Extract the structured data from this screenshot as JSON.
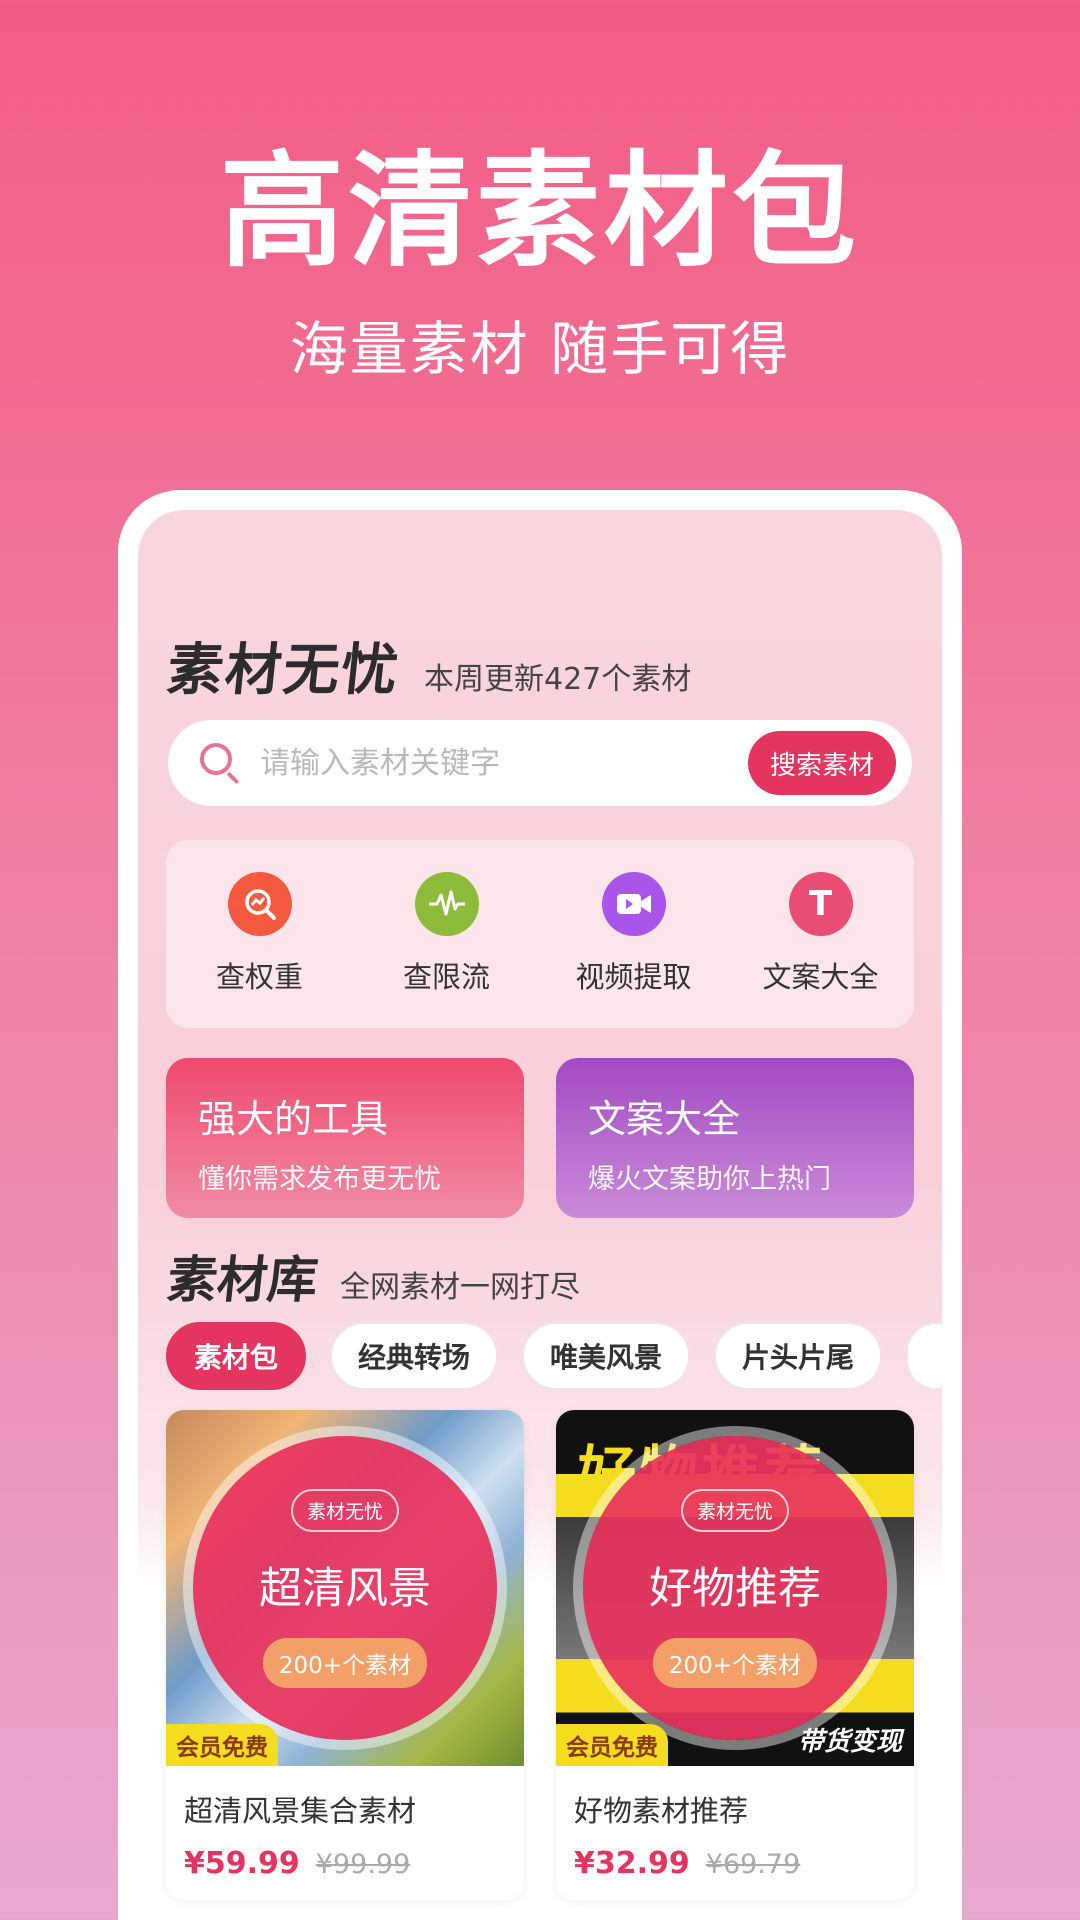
{
  "hero": {
    "title": "高清素材包",
    "subtitle": "海量素材 随手可得"
  },
  "app": {
    "brand": "素材无忧",
    "weekly_update": "本周更新427个素材",
    "search": {
      "placeholder": "请输入素材关键字",
      "value": "",
      "button": "搜索素材"
    },
    "tools": [
      {
        "label": "查权重",
        "icon": "chart-search-icon",
        "color": "#f45a3f"
      },
      {
        "label": "查限流",
        "icon": "pulse-wave-icon",
        "color": "#8fbb3b"
      },
      {
        "label": "视频提取",
        "icon": "video-camera-icon",
        "color": "#a955ea"
      },
      {
        "label": "文案大全",
        "icon": "letter-t-icon",
        "color": "#ea4d73",
        "glyph": "T"
      }
    ],
    "promos": [
      {
        "title": "强大的工具",
        "subtitle": "懂你需求发布更无忧"
      },
      {
        "title": "文案大全",
        "subtitle": "爆火文案助你上热门"
      }
    ],
    "library": {
      "title": "素材库",
      "subtitle": "全网素材一网打尽",
      "categories": [
        "素材包",
        "经典转场",
        "唯美风景",
        "片头片尾"
      ],
      "active_category": "素材包"
    },
    "products": [
      {
        "tag": "素材无忧",
        "cover_title": "超清风景",
        "count": "200+个素材",
        "badge": "会员免费",
        "name": "超清风景集合素材",
        "price": "¥59.99",
        "original_price": "¥99.99"
      },
      {
        "tag": "素材无忧",
        "cover_title": "好物推荐",
        "count": "200+个素材",
        "badge": "会员免费",
        "name": "好物素材推荐",
        "price": "¥32.99",
        "original_price": "¥69.79",
        "thumb_banner": "好物推荐",
        "thumb_corner": "带货变现"
      }
    ]
  }
}
